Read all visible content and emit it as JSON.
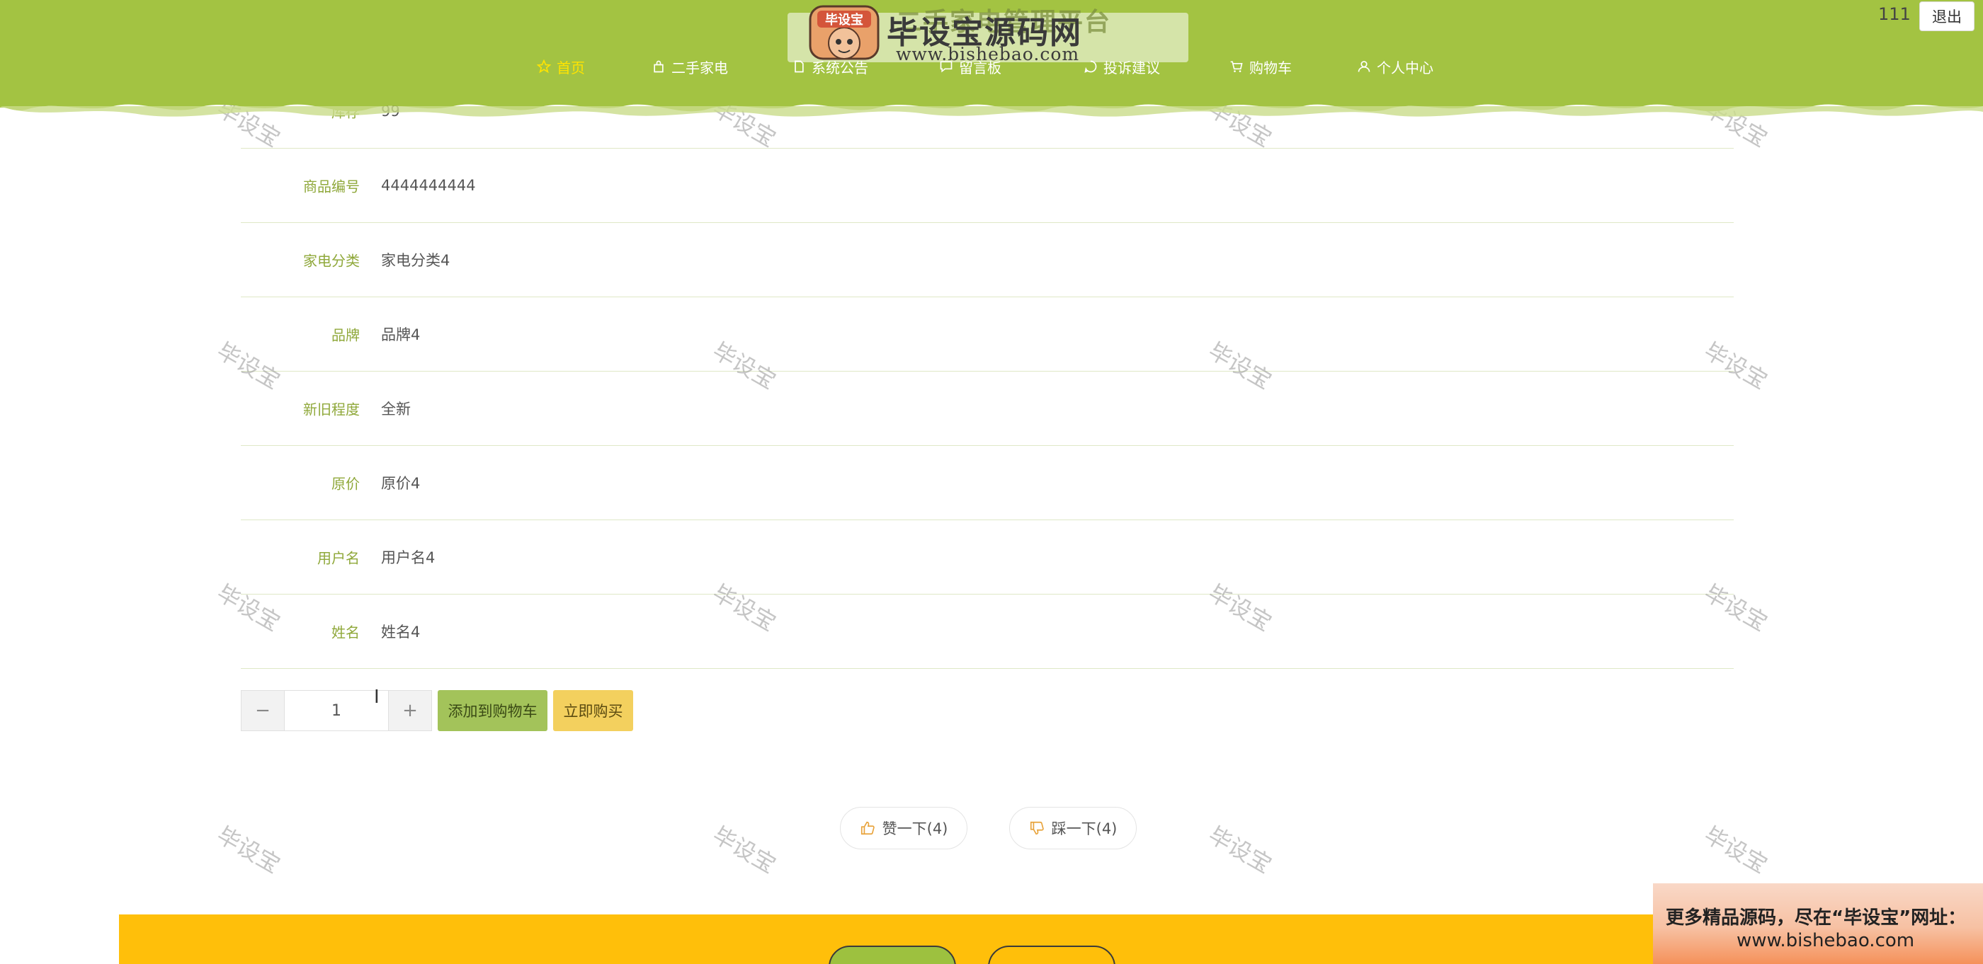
{
  "header": {
    "nav": [
      {
        "label": "首页",
        "icon": "star-icon",
        "active": true
      },
      {
        "label": "二手家电",
        "icon": "bag-icon",
        "active": false
      },
      {
        "label": "系统公告",
        "icon": "doc-icon",
        "active": false
      },
      {
        "label": "留言板",
        "icon": "message-icon",
        "active": false
      },
      {
        "label": "投诉建议",
        "icon": "feedback-icon",
        "active": false
      },
      {
        "label": "购物车",
        "icon": "cart-icon",
        "active": false
      },
      {
        "label": "个人中心",
        "icon": "user-icon",
        "active": false
      }
    ],
    "site_title": "二手家电管理平台",
    "username": "111",
    "logout_label": "退出",
    "colors": {
      "header_bg": "#a3c342",
      "active_nav": "#ffe400"
    }
  },
  "logo": {
    "badge_text": "毕设宝",
    "name": "毕设宝源码网",
    "url": "www.bishebao.com"
  },
  "details": [
    {
      "label": "库存",
      "value": "99"
    },
    {
      "label": "商品编号",
      "value": "4444444444"
    },
    {
      "label": "家电分类",
      "value": "家电分类4"
    },
    {
      "label": "品牌",
      "value": "品牌4"
    },
    {
      "label": "新旧程度",
      "value": "全新"
    },
    {
      "label": "原价",
      "value": "原价4"
    },
    {
      "label": "用户名",
      "value": "用户名4"
    },
    {
      "label": "姓名",
      "value": "姓名4"
    }
  ],
  "actions": {
    "quantity": "1",
    "minus_label": "−",
    "plus_label": "+",
    "add_to_cart": "添加到购物车",
    "buy_now": "立即购买",
    "like": "赞一下(4)",
    "dislike": "踩一下(4)"
  },
  "watermark": "毕设宝",
  "ad": {
    "line1": "更多精品源码，尽在“毕设宝”网址：",
    "line2": "www.bishebao.com"
  }
}
